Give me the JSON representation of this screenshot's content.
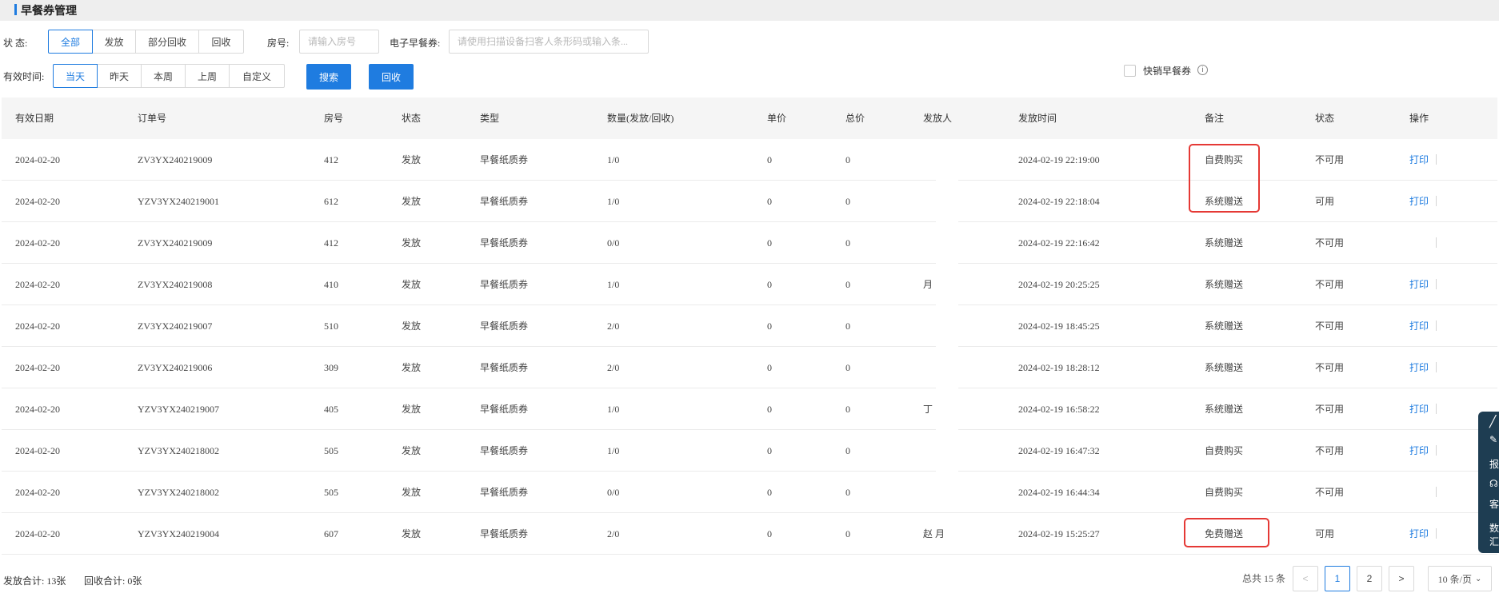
{
  "header": {
    "title": "早餐券管理"
  },
  "filters": {
    "status_label": "状    态:",
    "status_tabs": [
      "全部",
      "发放",
      "部分回收",
      "回收"
    ],
    "room_label": "房号:",
    "room_placeholder": "请输入房号",
    "ecoupon_label": "电子早餐券:",
    "ecoupon_placeholder": "请使用扫描设备扫客人条形码或输入条...",
    "time_label": "有效时间:",
    "time_tabs": [
      "当天",
      "昨天",
      "本周",
      "上周",
      "自定义"
    ],
    "search_label": "搜索",
    "recycle_label": "回收",
    "quick_label": "快销早餐券",
    "info_icon": "i"
  },
  "table": {
    "headers": [
      "有效日期",
      "订单号",
      "房号",
      "状态",
      "类型",
      "数量(发放/回收)",
      "单价",
      "总价",
      "发放人",
      "发放时间",
      "备注",
      "状态",
      "操作"
    ],
    "rows": [
      [
        "2024-02-20",
        "ZV3YX240219009",
        "412",
        "发放",
        "早餐纸质券",
        "1/0",
        "0",
        "0",
        "",
        "2024-02-19 22:19:00",
        "自费购买",
        "不可用",
        "打印"
      ],
      [
        "2024-02-20",
        "YZV3YX240219001",
        "612",
        "发放",
        "早餐纸质券",
        "1/0",
        "0",
        "0",
        "",
        "2024-02-19 22:18:04",
        "系统赠送",
        "可用",
        "打印"
      ],
      [
        "2024-02-20",
        "ZV3YX240219009",
        "412",
        "发放",
        "早餐纸质券",
        "0/0",
        "0",
        "0",
        "",
        "2024-02-19 22:16:42",
        "系统赠送",
        "不可用",
        ""
      ],
      [
        "2024-02-20",
        "ZV3YX240219008",
        "410",
        "发放",
        "早餐纸质券",
        "1/0",
        "0",
        "0",
        "月",
        "2024-02-19 20:25:25",
        "系统赠送",
        "不可用",
        "打印"
      ],
      [
        "2024-02-20",
        "ZV3YX240219007",
        "510",
        "发放",
        "早餐纸质券",
        "2/0",
        "0",
        "0",
        "",
        "2024-02-19 18:45:25",
        "系统赠送",
        "不可用",
        "打印"
      ],
      [
        "2024-02-20",
        "ZV3YX240219006",
        "309",
        "发放",
        "早餐纸质券",
        "2/0",
        "0",
        "0",
        "",
        "2024-02-19 18:28:12",
        "系统赠送",
        "不可用",
        "打印"
      ],
      [
        "2024-02-20",
        "YZV3YX240219007",
        "405",
        "发放",
        "早餐纸质券",
        "1/0",
        "0",
        "0",
        "丁",
        "2024-02-19 16:58:22",
        "系统赠送",
        "不可用",
        "打印"
      ],
      [
        "2024-02-20",
        "YZV3YX240218002",
        "505",
        "发放",
        "早餐纸质券",
        "1/0",
        "0",
        "0",
        "",
        "2024-02-19 16:47:32",
        "自费购买",
        "不可用",
        "打印"
      ],
      [
        "2024-02-20",
        "YZV3YX240218002",
        "505",
        "发放",
        "早餐纸质券",
        "0/0",
        "0",
        "0",
        "",
        "2024-02-19 16:44:34",
        "自费购买",
        "不可用",
        ""
      ],
      [
        "2024-02-20",
        "YZV3YX240219004",
        "607",
        "发放",
        "早餐纸质券",
        "2/0",
        "0",
        "0",
        "赵  月",
        "2024-02-19 15:25:27",
        "免费赠送",
        "可用",
        "打印"
      ]
    ]
  },
  "footer": {
    "issued_total": "发放合计: 13张",
    "recycled_total": "回收合计: 0张"
  },
  "pagination": {
    "total_text": "总共 15 条",
    "prev": "<",
    "pages": [
      "1",
      "2"
    ],
    "next": ">",
    "page_size": "10 条/页"
  },
  "side_panel": {
    "items": [
      "报",
      "客",
      "数",
      "汇"
    ]
  }
}
